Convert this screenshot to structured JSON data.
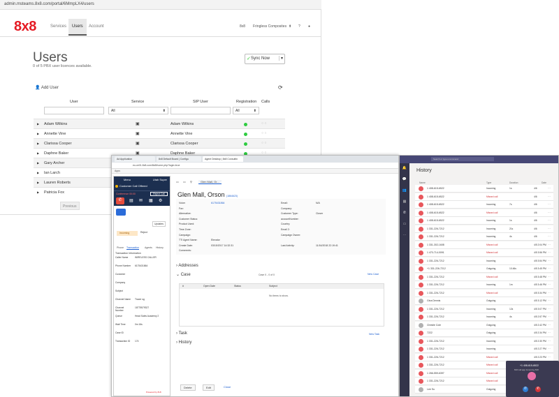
{
  "admin": {
    "url": "admin.msteams.8x8.com/portal/6MmpLX4/users",
    "logo": "8x8",
    "nav": [
      "Services",
      "Users",
      "Account"
    ],
    "right_nav": [
      "8x8",
      "Fringless Composites"
    ],
    "title": "Users",
    "subtitle": "0 of 5 PBX user licences available.",
    "sync_label": "Sync Now",
    "add_user": "Add User",
    "columns": [
      "User",
      "Service",
      "SIP User",
      "Registration",
      "Calls"
    ],
    "filter_all": "All",
    "rows": [
      {
        "name": "Adam Wilkins",
        "sip": "Adam Wilkins"
      },
      {
        "name": "Annette Vine",
        "sip": "Annette Vine"
      },
      {
        "name": "Clarissa Cooper",
        "sip": "Clarissa Cooper"
      },
      {
        "name": "Daphne Baker",
        "sip": "Daphne Baker"
      },
      {
        "name": "Gary Archer",
        "sip": ""
      },
      {
        "name": "Ian Larch",
        "sip": ""
      },
      {
        "name": "Lauren Roberts",
        "sip": ""
      },
      {
        "name": "Patricia Fox",
        "sip": ""
      }
    ],
    "previous": "Previous"
  },
  "agent": {
    "tabs": [
      "Ad Application",
      "8x8 Default Board | Configu",
      "Agent Desktop | 8x8 Consultin"
    ],
    "url": "eu-ce01.8x8.com/8x8/home.php?login=true",
    "bookmarks": "Apps",
    "phone": {
      "menu": "Menu",
      "status_user": "Utah Super",
      "state": "Customer Call Offered",
      "timer": "Conference 00:00",
      "reject": "Reject Call",
      "updates": "Updates",
      "incoming": "Incoming",
      "reject2": "Reject",
      "tabs": [
        "Phone",
        "Transaction",
        "Agents",
        "History"
      ],
      "info_title": "Transaction Information",
      "fields": [
        [
          "Caller Name",
          "WIRELESS CALLER"
        ],
        [
          "Phone Number",
          "6175431864"
        ],
        [
          "Customer",
          ""
        ],
        [
          "Company",
          ""
        ],
        [
          "Subject",
          ""
        ],
        [
          "Channel Name",
          "Tracer sg"
        ],
        [
          "Channel Number",
          "18775579327"
        ],
        [
          "Queue",
          "Head Sales Academy 2"
        ],
        [
          "Wait Time",
          "0m 16s"
        ],
        [
          "Case ID",
          ""
        ],
        [
          "Transaction ID",
          "174"
        ]
      ],
      "powered": "Powered by 8x8"
    },
    "crm_tabs": [
      "Glen Mall, Or..."
    ],
    "crm": {
      "name": "Glen Mall, Orson",
      "id": "(1864623)",
      "left_fields": [
        [
          "Voice:",
          "6175431864"
        ],
        [
          "Fax:",
          ""
        ],
        [
          "Alternative:",
          ""
        ],
        [
          "Customer Status:",
          ""
        ],
        [
          "Product Used:",
          ""
        ],
        [
          "Time Zone:",
          ""
        ],
        [
          "Campaign:",
          ""
        ],
        [
          "TTI Agent Name:",
          "Elevator"
        ],
        [
          "Create Date:",
          "03/15/2017 14:32:31"
        ],
        [
          "Comments:",
          ""
        ]
      ],
      "right_fields": [
        [
          "Email:",
          "N/A"
        ],
        [
          "Company:",
          ""
        ],
        [
          "Customer Type:",
          "Closer"
        ],
        [
          "accountNumber:",
          ""
        ],
        [
          "Country:",
          ""
        ],
        [
          "Email 2:",
          ""
        ],
        [
          "Campaign Owner:",
          ""
        ],
        [
          "",
          ""
        ],
        [
          "Last Activity:",
          "11/16/2018 22:19:41"
        ],
        [
          "",
          ""
        ]
      ],
      "sections": [
        "Addresses",
        "Case",
        "Task",
        "History"
      ],
      "case_cols": [
        "#",
        "Open Date",
        "Status",
        "Subject"
      ],
      "case_pager": "Case 0 - 0 of 0",
      "new_case": "New Case",
      "no_items": "No items to show.",
      "new_task": "New Task",
      "buttons": [
        "Delete",
        "Edit",
        "Close"
      ]
    }
  },
  "teams": {
    "search": "Search or type a command",
    "title": "History",
    "columns": [
      "Name",
      "Type",
      "Duration",
      "Date"
    ],
    "rows": [
      {
        "num": "1 408-615-6522",
        "type": "Incoming",
        "dur": "1s",
        "date": "4/6",
        "miss": false
      },
      {
        "num": "1 408-615-6522",
        "type": "Missed call",
        "dur": "",
        "date": "4/6",
        "miss": true
      },
      {
        "num": "1 408-615-6522",
        "type": "Incoming",
        "dur": "7s",
        "date": "4/6",
        "miss": false
      },
      {
        "num": "1 408-615-6522",
        "type": "Missed call",
        "dur": "",
        "date": "4/6",
        "miss": true
      },
      {
        "num": "1 408-615-6522",
        "type": "Incoming",
        "dur": "1s",
        "date": "4/6",
        "miss": false
      },
      {
        "num": "1 331-226-7212",
        "type": "Incoming",
        "dur": "21s",
        "date": "4/6",
        "miss": false
      },
      {
        "num": "1 331-226-7212",
        "type": "Incoming",
        "dur": "4s",
        "date": "4/6",
        "miss": false
      },
      {
        "num": "1 331-302-1608",
        "type": "Missed call",
        "dur": "",
        "date": "4/5 2:04 PM",
        "miss": true
      },
      {
        "num": "1 470-714-0091",
        "type": "Missed call",
        "dur": "",
        "date": "4/5 3:56 PM",
        "miss": true
      },
      {
        "num": "1 331-226-7212",
        "type": "Incoming",
        "dur": "",
        "date": "4/5 3:54 PM",
        "miss": false
      },
      {
        "num": "+1 331-226-7212",
        "type": "Outgoing",
        "dur": "10.46s",
        "date": "4/5 3:45 PM",
        "miss": false
      },
      {
        "num": "1 331-226-7212",
        "type": "Missed call",
        "dur": "",
        "date": "4/5 3:48 PM",
        "miss": true
      },
      {
        "num": "1 331-226-7212",
        "type": "Incoming",
        "dur": "1m",
        "date": "4/5 3:46 PM",
        "miss": false
      },
      {
        "num": "1 331-226-7212",
        "type": "Missed call",
        "dur": "",
        "date": "4/5 3:34 PM",
        "miss": true
      },
      {
        "num": "Gina Dennis",
        "type": "Outgoing",
        "dur": "",
        "date": "4/5 3:12 PM",
        "miss": false,
        "grey": true
      },
      {
        "num": "1 331-226-7212",
        "type": "Incoming",
        "dur": "12s",
        "date": "4/5 3:07 PM",
        "miss": false
      },
      {
        "num": "1 331-226-7212",
        "type": "Incoming",
        "dur": "4s",
        "date": "4/5 2:57 PM",
        "miss": false
      },
      {
        "num": "Christie Cole",
        "type": "Outgoing",
        "dur": "",
        "date": "4/5 2:42 PM",
        "miss": false,
        "grey": true
      },
      {
        "num": "7222",
        "type": "Outgoing",
        "dur": "",
        "date": "4/5 2:34 PM",
        "miss": false
      },
      {
        "num": "1 331-226-7212",
        "type": "Incoming",
        "dur": "",
        "date": "4/5 2:30 PM",
        "miss": false
      },
      {
        "num": "1 331-226-7212",
        "type": "Incoming",
        "dur": "",
        "date": "4/5 2:27 PM",
        "miss": false
      },
      {
        "num": "1 331-226-7212",
        "type": "Missed call",
        "dur": "",
        "date": "4/5 2:23 PM",
        "miss": true
      },
      {
        "num": "1 331-226-7212",
        "type": "Missed call",
        "dur": "",
        "date": "4/5",
        "miss": true
      },
      {
        "num": "1 266-559-6397",
        "type": "Missed call",
        "dur": "",
        "date": "4/5",
        "miss": true
      },
      {
        "num": "1 331-226-7212",
        "type": "Missed call",
        "dur": "",
        "date": "4/5",
        "miss": true
      },
      {
        "num": "Lee Su",
        "type": "Outgoing",
        "dur": "",
        "date": "4/5",
        "miss": false,
        "grey": true
      }
    ],
    "call": {
      "number": "+1 408-615-6522",
      "sub": "8x8 call app Incoming 8x8"
    }
  }
}
